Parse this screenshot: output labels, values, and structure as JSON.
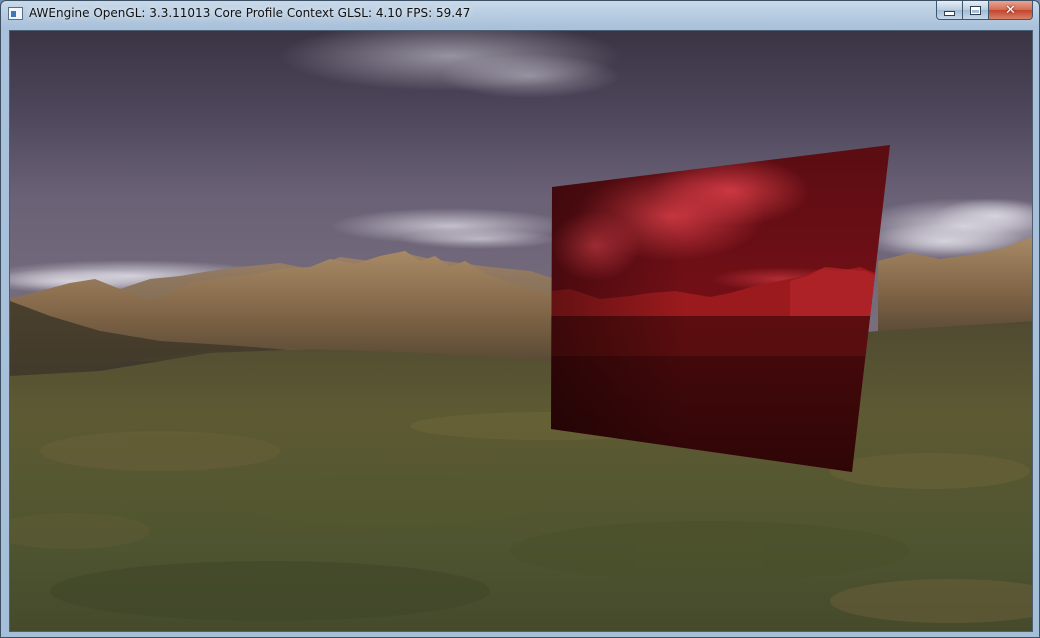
{
  "window": {
    "title": "AWEngine OpenGL: 3.3.11013 Core Profile Context GLSL: 4.10 FPS: 59.47",
    "icon": "application-window-icon"
  },
  "caption_buttons": {
    "minimize": "minimize-icon",
    "maximize": "maximize-icon",
    "close": "close-icon",
    "close_glyph": "✕"
  },
  "scene": {
    "sky_color": "#5a536a",
    "terrain_color": "#5f5a34",
    "mountain_color": "#8a6e4c",
    "quad_tint": "#b3202a"
  }
}
